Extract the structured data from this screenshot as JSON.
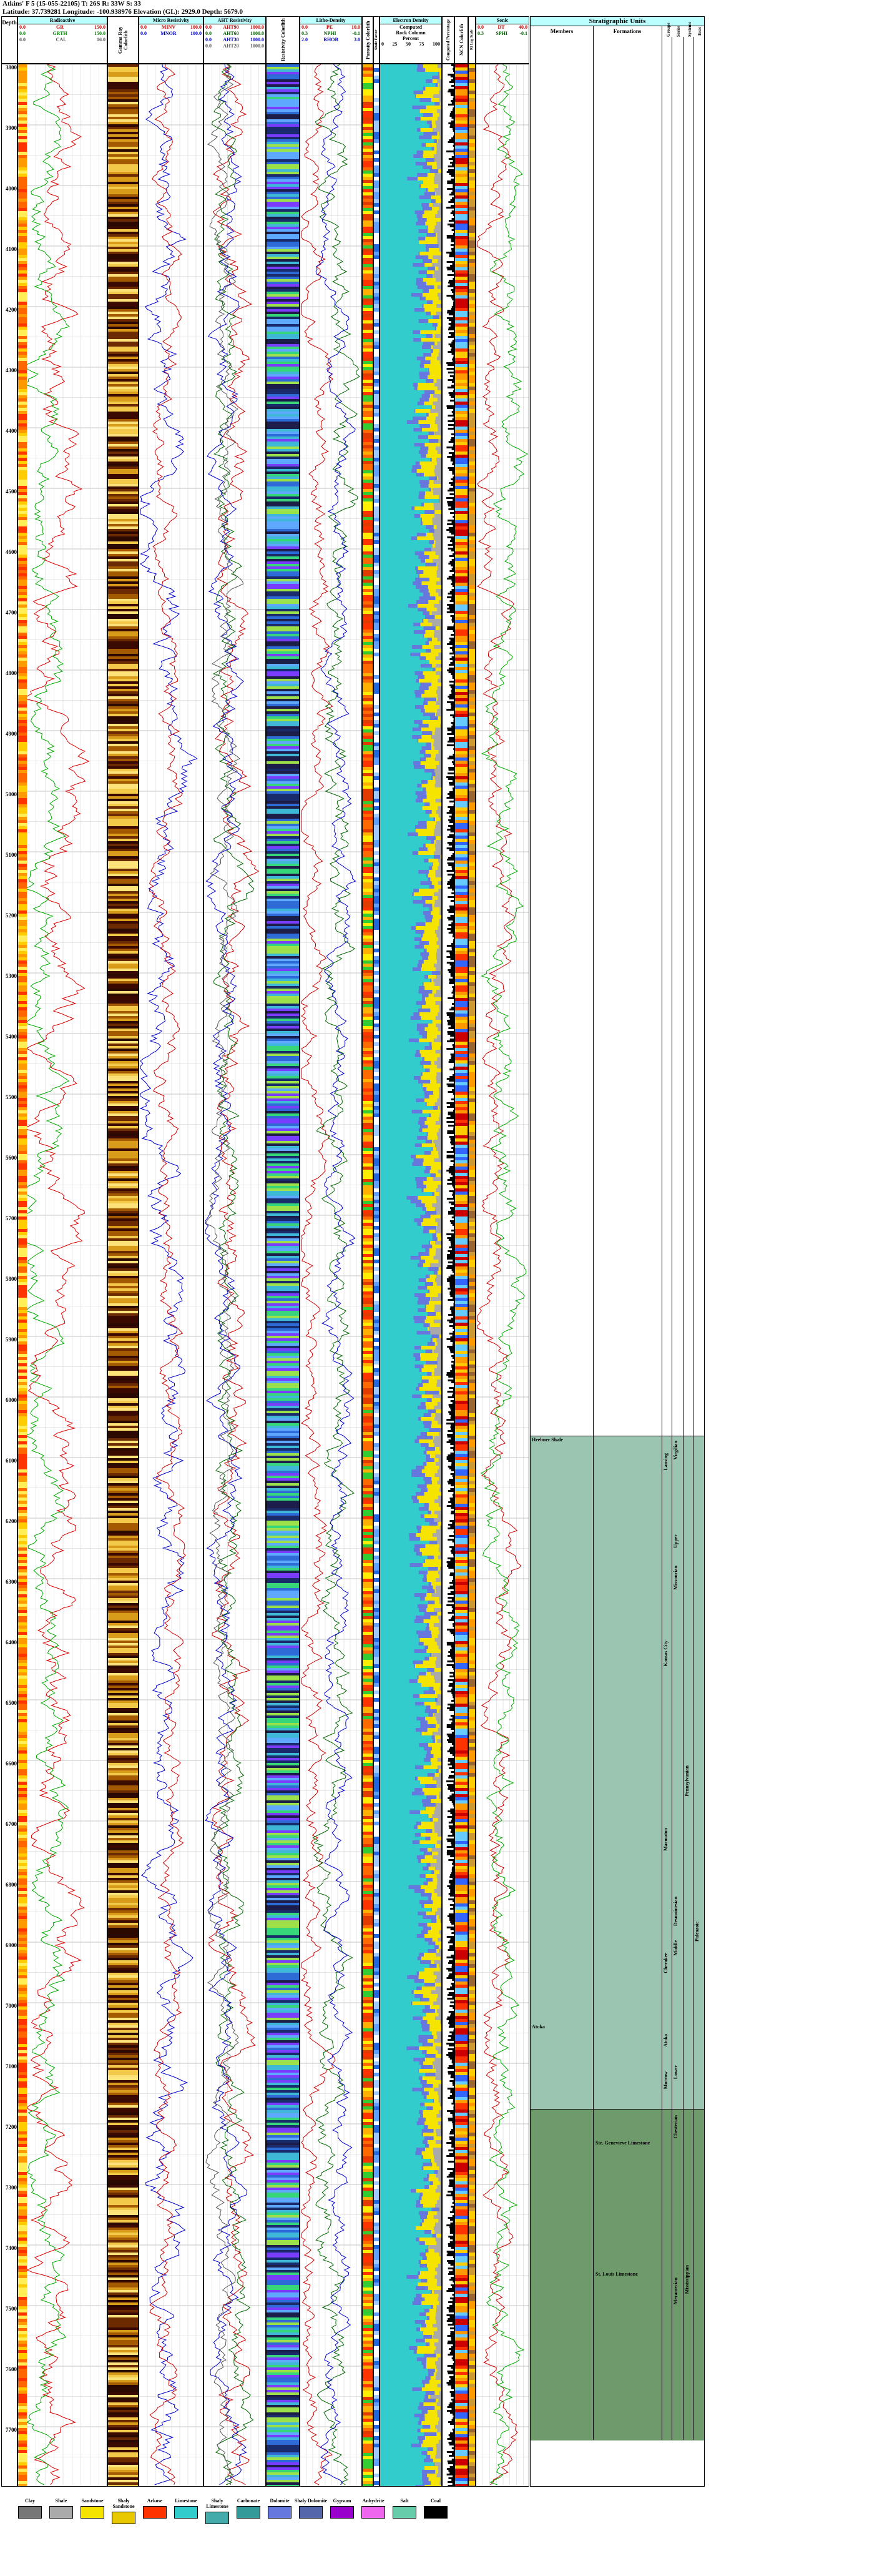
{
  "header": {
    "line1": "Atkins' F 5 (15-055-22105) T: 26S R: 33W S: 33",
    "line2": "Latitude: 37.739281 Longitude: -100.938976 Elevation (GL): 2929.0 Depth: 5679.0"
  },
  "columns": {
    "depth": "Depth",
    "gamma": {
      "title": "Radioactive",
      "curves": [
        {
          "name": "GR",
          "min": "0.0",
          "max": "150.0"
        },
        {
          "name": "GRTH",
          "min": "0.0",
          "max": "150.0"
        },
        {
          "name": "CAL",
          "min": "6.0",
          "max": "16.0"
        }
      ]
    },
    "litho1": "Gamma Ray Colorlith",
    "micro": {
      "title": "Micro Resistivity",
      "curves": [
        {
          "name": "MINV",
          "min": "0.0",
          "max": "100.0"
        },
        {
          "name": "MNOR",
          "min": "0.0",
          "max": "100.0"
        }
      ]
    },
    "aht": {
      "title": "AHT Resistivity",
      "curves": [
        {
          "name": "AHT90",
          "min": "0.0",
          "max": "1000.0"
        },
        {
          "name": "AHT60",
          "min": "0.0",
          "max": "1000.0"
        },
        {
          "name": "AHT30",
          "min": "0.0",
          "max": "1000.0"
        },
        {
          "name": "AHT20",
          "min": "0.0",
          "max": "1000.0"
        }
      ]
    },
    "litho2": "Resistivity Colorlith",
    "density": {
      "title": "Litho-Density",
      "curves": [
        {
          "name": "PE",
          "min": "0.0",
          "max": "10.0"
        },
        {
          "name": "NPHI",
          "min": "0.3",
          "max": "-0.1"
        },
        {
          "name": "RHOB",
          "min": "2.0",
          "max": "3.0"
        }
      ]
    },
    "phi": "Porosity Colorlith",
    "shale": "Shale Factor",
    "rock": {
      "title": "Electron Density",
      "lines": [
        "Computed",
        "Rock Column",
        "Percent"
      ],
      "scale": [
        "0",
        "25",
        "50",
        "75",
        "100"
      ]
    },
    "pct": "Computed Percentage",
    "ncn": "NCN Colorlith",
    "rt": "Rt Log Scale",
    "sonic": {
      "title": "Sonic",
      "curves": [
        {
          "name": "DT",
          "min": "0.0",
          "max": "40.0"
        },
        {
          "name": "SPHI",
          "min": "0.3",
          "max": "-0.1"
        }
      ]
    },
    "fill": "Porosity Fill"
  },
  "depths": [
    "3800",
    "3900",
    "4000",
    "4100",
    "4200",
    "4300",
    "4400",
    "4500",
    "4600",
    "4700",
    "4800",
    "4900",
    "5000",
    "5100",
    "5200",
    "5300",
    "5400",
    "5500",
    "5600",
    "5700",
    "5800",
    "5900",
    "6000",
    "6100",
    "6200",
    "6300",
    "6400",
    "6500",
    "6600",
    "6700",
    "6800",
    "6900",
    "7000",
    "7100",
    "7200",
    "7300",
    "7400",
    "7500",
    "7600",
    "7700"
  ],
  "strat": {
    "title": "Stratigraphic Units",
    "members": "Members",
    "formations": "Formations",
    "groups": "Groups",
    "series": "Series",
    "systems": "Systems",
    "eras": "Eras",
    "units": {
      "heebner": "Heebner Shale",
      "morrow": "Atoka",
      "ste_gen": "Ste. Genevieve Limestone",
      "st_louis": "St. Louis Limestone",
      "lansing": "Lansing",
      "kc": "Kansas City",
      "marmaton": "Marmaton",
      "cherokee": "Cherokee",
      "atoka": "Atoka",
      "morrow2": "Morrow",
      "virgilian": "Virgilian",
      "upper": "Upper",
      "missourian": "Missourian",
      "desm": "Desmoinesian",
      "middle": "Middle",
      "lower": "Lower",
      "chester": "Chesterian",
      "meramec": "Meramecian",
      "penn": "Pennsylvanian",
      "miss": "Mississippian",
      "paleo": "Paleozoic"
    }
  },
  "legend": [
    {
      "label": "Clay",
      "color": "#777777"
    },
    {
      "label": "Shale",
      "color": "#aaaaaa"
    },
    {
      "label": "Sandstone",
      "color": "#f5e400"
    },
    {
      "label": "Shaly Sandstone",
      "color": "#e8c800"
    },
    {
      "label": "Arkose",
      "color": "#ff3300"
    },
    {
      "label": "Limestone",
      "color": "#33cccc"
    },
    {
      "label": "Shaly Limestone",
      "color": "#44aaaa"
    },
    {
      "label": "Carbonate",
      "color": "#339999"
    },
    {
      "label": "Dolomite",
      "color": "#6677dd"
    },
    {
      "label": "Shaly Dolomite",
      "color": "#5566aa"
    },
    {
      "label": "Gypsum",
      "color": "#9900cc"
    },
    {
      "label": "Anhydrite",
      "color": "#ee66ee"
    },
    {
      "label": "Salt",
      "color": "#66ccaa"
    },
    {
      "label": "Coal",
      "color": "#000000"
    }
  ]
}
